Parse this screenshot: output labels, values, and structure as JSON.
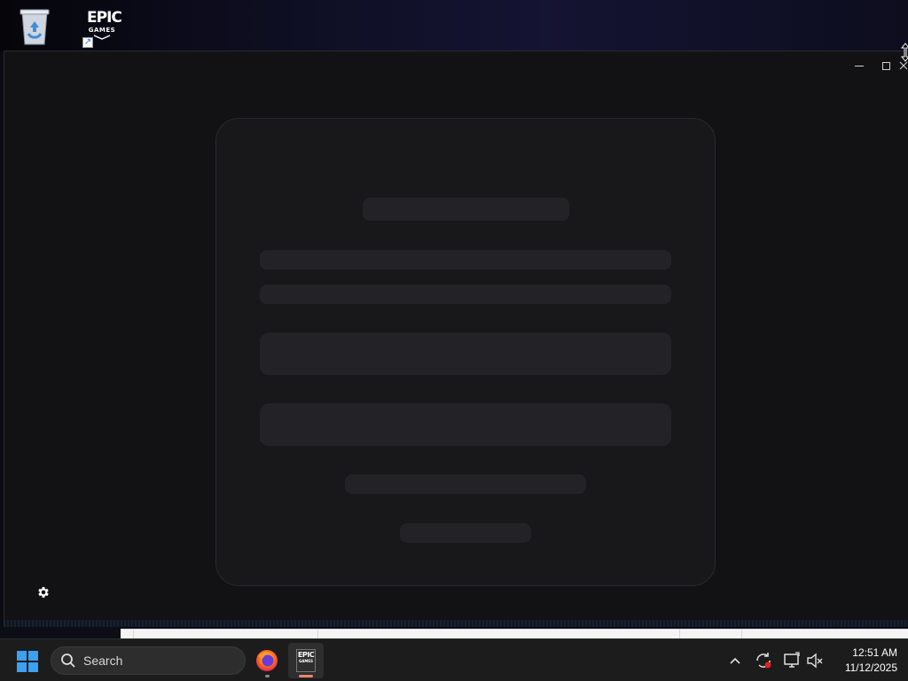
{
  "desktop": {
    "icons": [
      {
        "name": "Recycle Bin",
        "icon": "recycle-bin-icon"
      },
      {
        "name": "Epic Games Launcher",
        "icon": "epic-games-logo",
        "logo_line1": "EPIC",
        "logo_line2": "GAMES"
      }
    ]
  },
  "window": {
    "controls": [
      "minimize",
      "maximize",
      "close"
    ],
    "state": "loading",
    "settings_icon": "gear-icon"
  },
  "taskbar": {
    "search_label": "Search",
    "pinned_apps": [
      {
        "name": "Firefox",
        "icon": "firefox-icon",
        "running": true
      },
      {
        "name": "Epic Games Launcher",
        "icon": "epic-games-icon",
        "active": true,
        "logo_line1": "EPIC",
        "logo_line2": "GAMES"
      }
    ],
    "tray_icons": [
      "chevron-up-icon",
      "sync-icon",
      "display-icon",
      "volume-muted-icon"
    ],
    "clock": {
      "time": "12:51 AM",
      "date": "11/12/2025"
    }
  },
  "colors": {
    "window_bg": "#121214",
    "card_bg": "#18181b",
    "skeleton": "#232327",
    "taskbar_bg": "#1c1c1c",
    "epic_accent": "#e58a6c"
  }
}
